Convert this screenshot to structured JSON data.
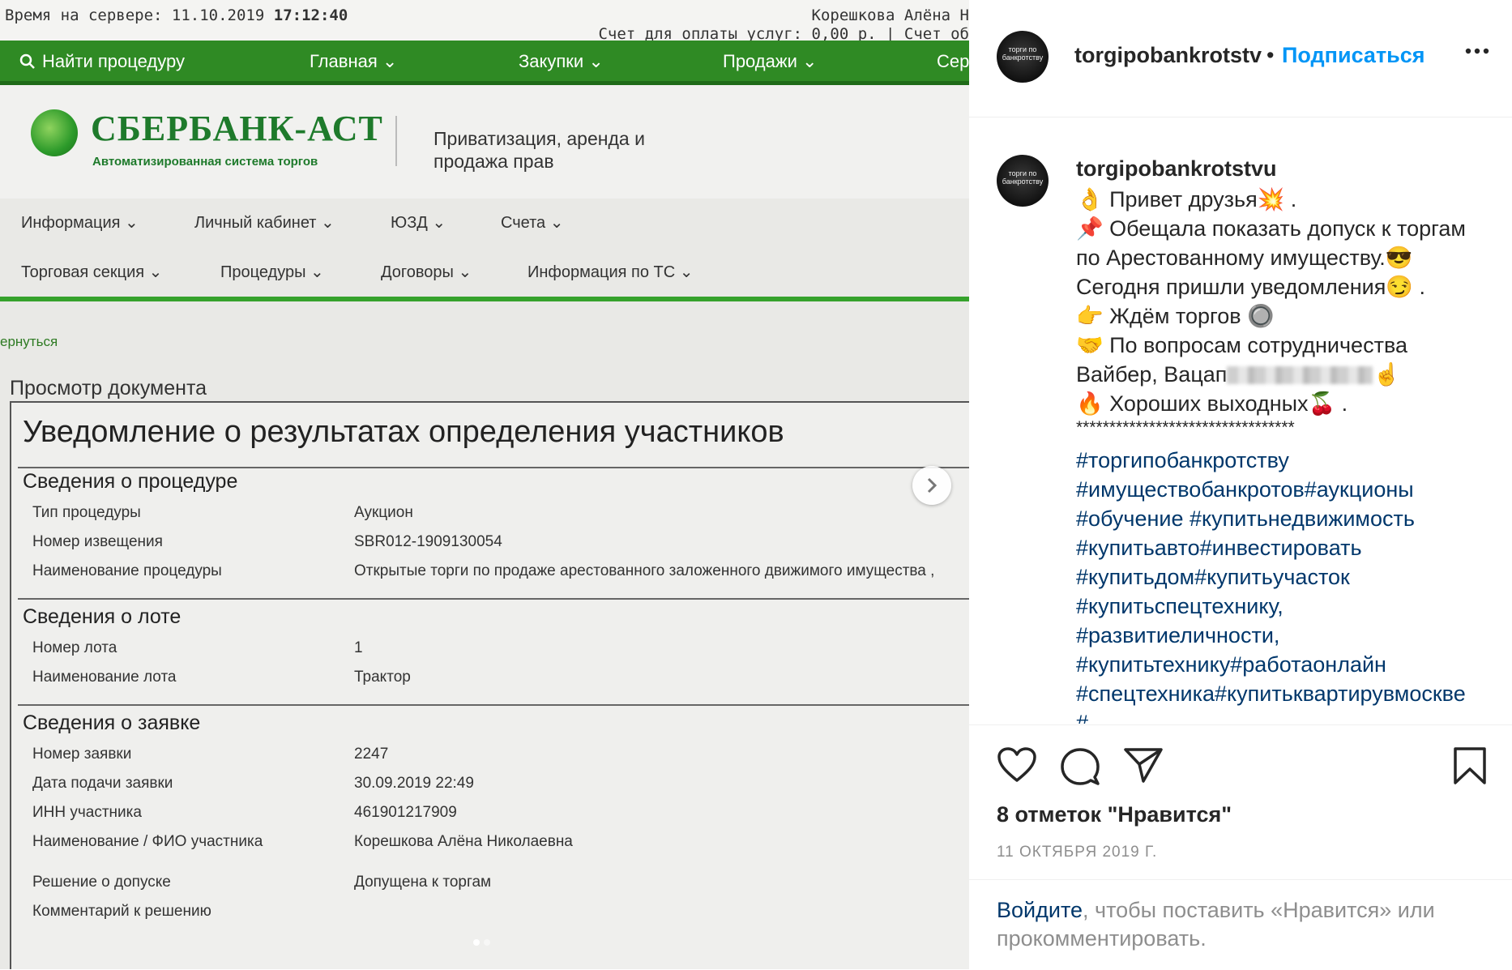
{
  "photo": {
    "topbar": {
      "server_label": "Время на сервере: 11.10.2019",
      "server_time": "17:12:40",
      "user_name": "Корешкова Алёна Н",
      "account": "Счет для оплаты услуг: 0,00 р. | Счет об"
    },
    "nav": {
      "find": "Найти процедуру",
      "items": [
        "Главная",
        "Закупки",
        "Продажи",
        "Сер"
      ]
    },
    "header": {
      "logo": "СБЕРБАНК-АСТ",
      "logo_sub": "Автоматизированная система торгов",
      "title": "Приватизация, аренда и продажа прав"
    },
    "menu1": [
      "Информация",
      "Личный кабинет",
      "ЮЗД",
      "Счета"
    ],
    "menu2": [
      "Торговая секция",
      "Процедуры",
      "Договоры",
      "Информация по ТС"
    ],
    "back": "ернуться",
    "doc_label": "Просмотр документа",
    "doc_title": "Уведомление о результатах определения участников",
    "sections": [
      {
        "title": "Сведения о процедуре",
        "rows": [
          {
            "label": "Тип процедуры",
            "value": "Аукцион"
          },
          {
            "label": "Номер извещения",
            "value": "SBR012-1909130054"
          },
          {
            "label": "Наименование процедуры",
            "value": "Открытые торги по продаже арестованного заложенного движимого имущества ,"
          }
        ]
      },
      {
        "title": "Сведения о лоте",
        "rows": [
          {
            "label": "Номер лота",
            "value": "1"
          },
          {
            "label": "Наименование лота",
            "value": "Трактор"
          }
        ]
      },
      {
        "title": "Сведения о заявке",
        "rows": [
          {
            "label": "Номер заявки",
            "value": "2247"
          },
          {
            "label": "Дата подачи заявки",
            "value": "30.09.2019 22:49"
          },
          {
            "label": "ИНН участника",
            "value": "461901217909"
          },
          {
            "label": "Наименование / ФИО участника",
            "value": "Корешкова Алёна Николаевна"
          },
          {
            "label": "Решение о допуске",
            "value": "Допущена к торгам"
          },
          {
            "label": "Комментарий к решению",
            "value": ""
          }
        ]
      }
    ]
  },
  "post": {
    "avatar_text": "торги по банкротству",
    "username": "torgipobankrotstv",
    "dot": "•",
    "follow": "Подписаться",
    "caption_user": "torgipobankrotstvu",
    "caption_lines": [
      "👌 Привет друзья💥 .",
      "📌 Обещала показать допуск к торгам",
      "по Арестованному имуществу.😎",
      "Сегодня пришли уведомления😏 .",
      "👉 Ждём торгов 🔘",
      "🤝 По вопросам сотрудничества",
      "Вайбер, Вацап",
      "🔥 Хороших выходных🍒 .",
      "*********************************"
    ],
    "caption_blur_suffix": "☝️",
    "hashtags": [
      "#торгипобанкротству",
      "#имуществобанкротов#аукционы",
      "#обучение #купитьнедвижимость",
      "#купитьавто#инвестировать",
      "#купитьдом#купитьучасток",
      "#купитьспецтехнику,",
      "#развитиеличности,",
      "#купитьтехнику#работаонлайн",
      "#спецтехника#купитьквартирувмоскве",
      "#"
    ],
    "likes": "8 отметок \"Нравится\"",
    "date": "11 ОКТЯБРЯ 2019 Г.",
    "login_link": "Войдите",
    "login_text": ", чтобы поставить «Нравится» или прокомментировать."
  },
  "colors": {
    "nav_green": "#2f8a24",
    "link_blue": "#0095f6",
    "hashtag_blue": "#00376b"
  }
}
